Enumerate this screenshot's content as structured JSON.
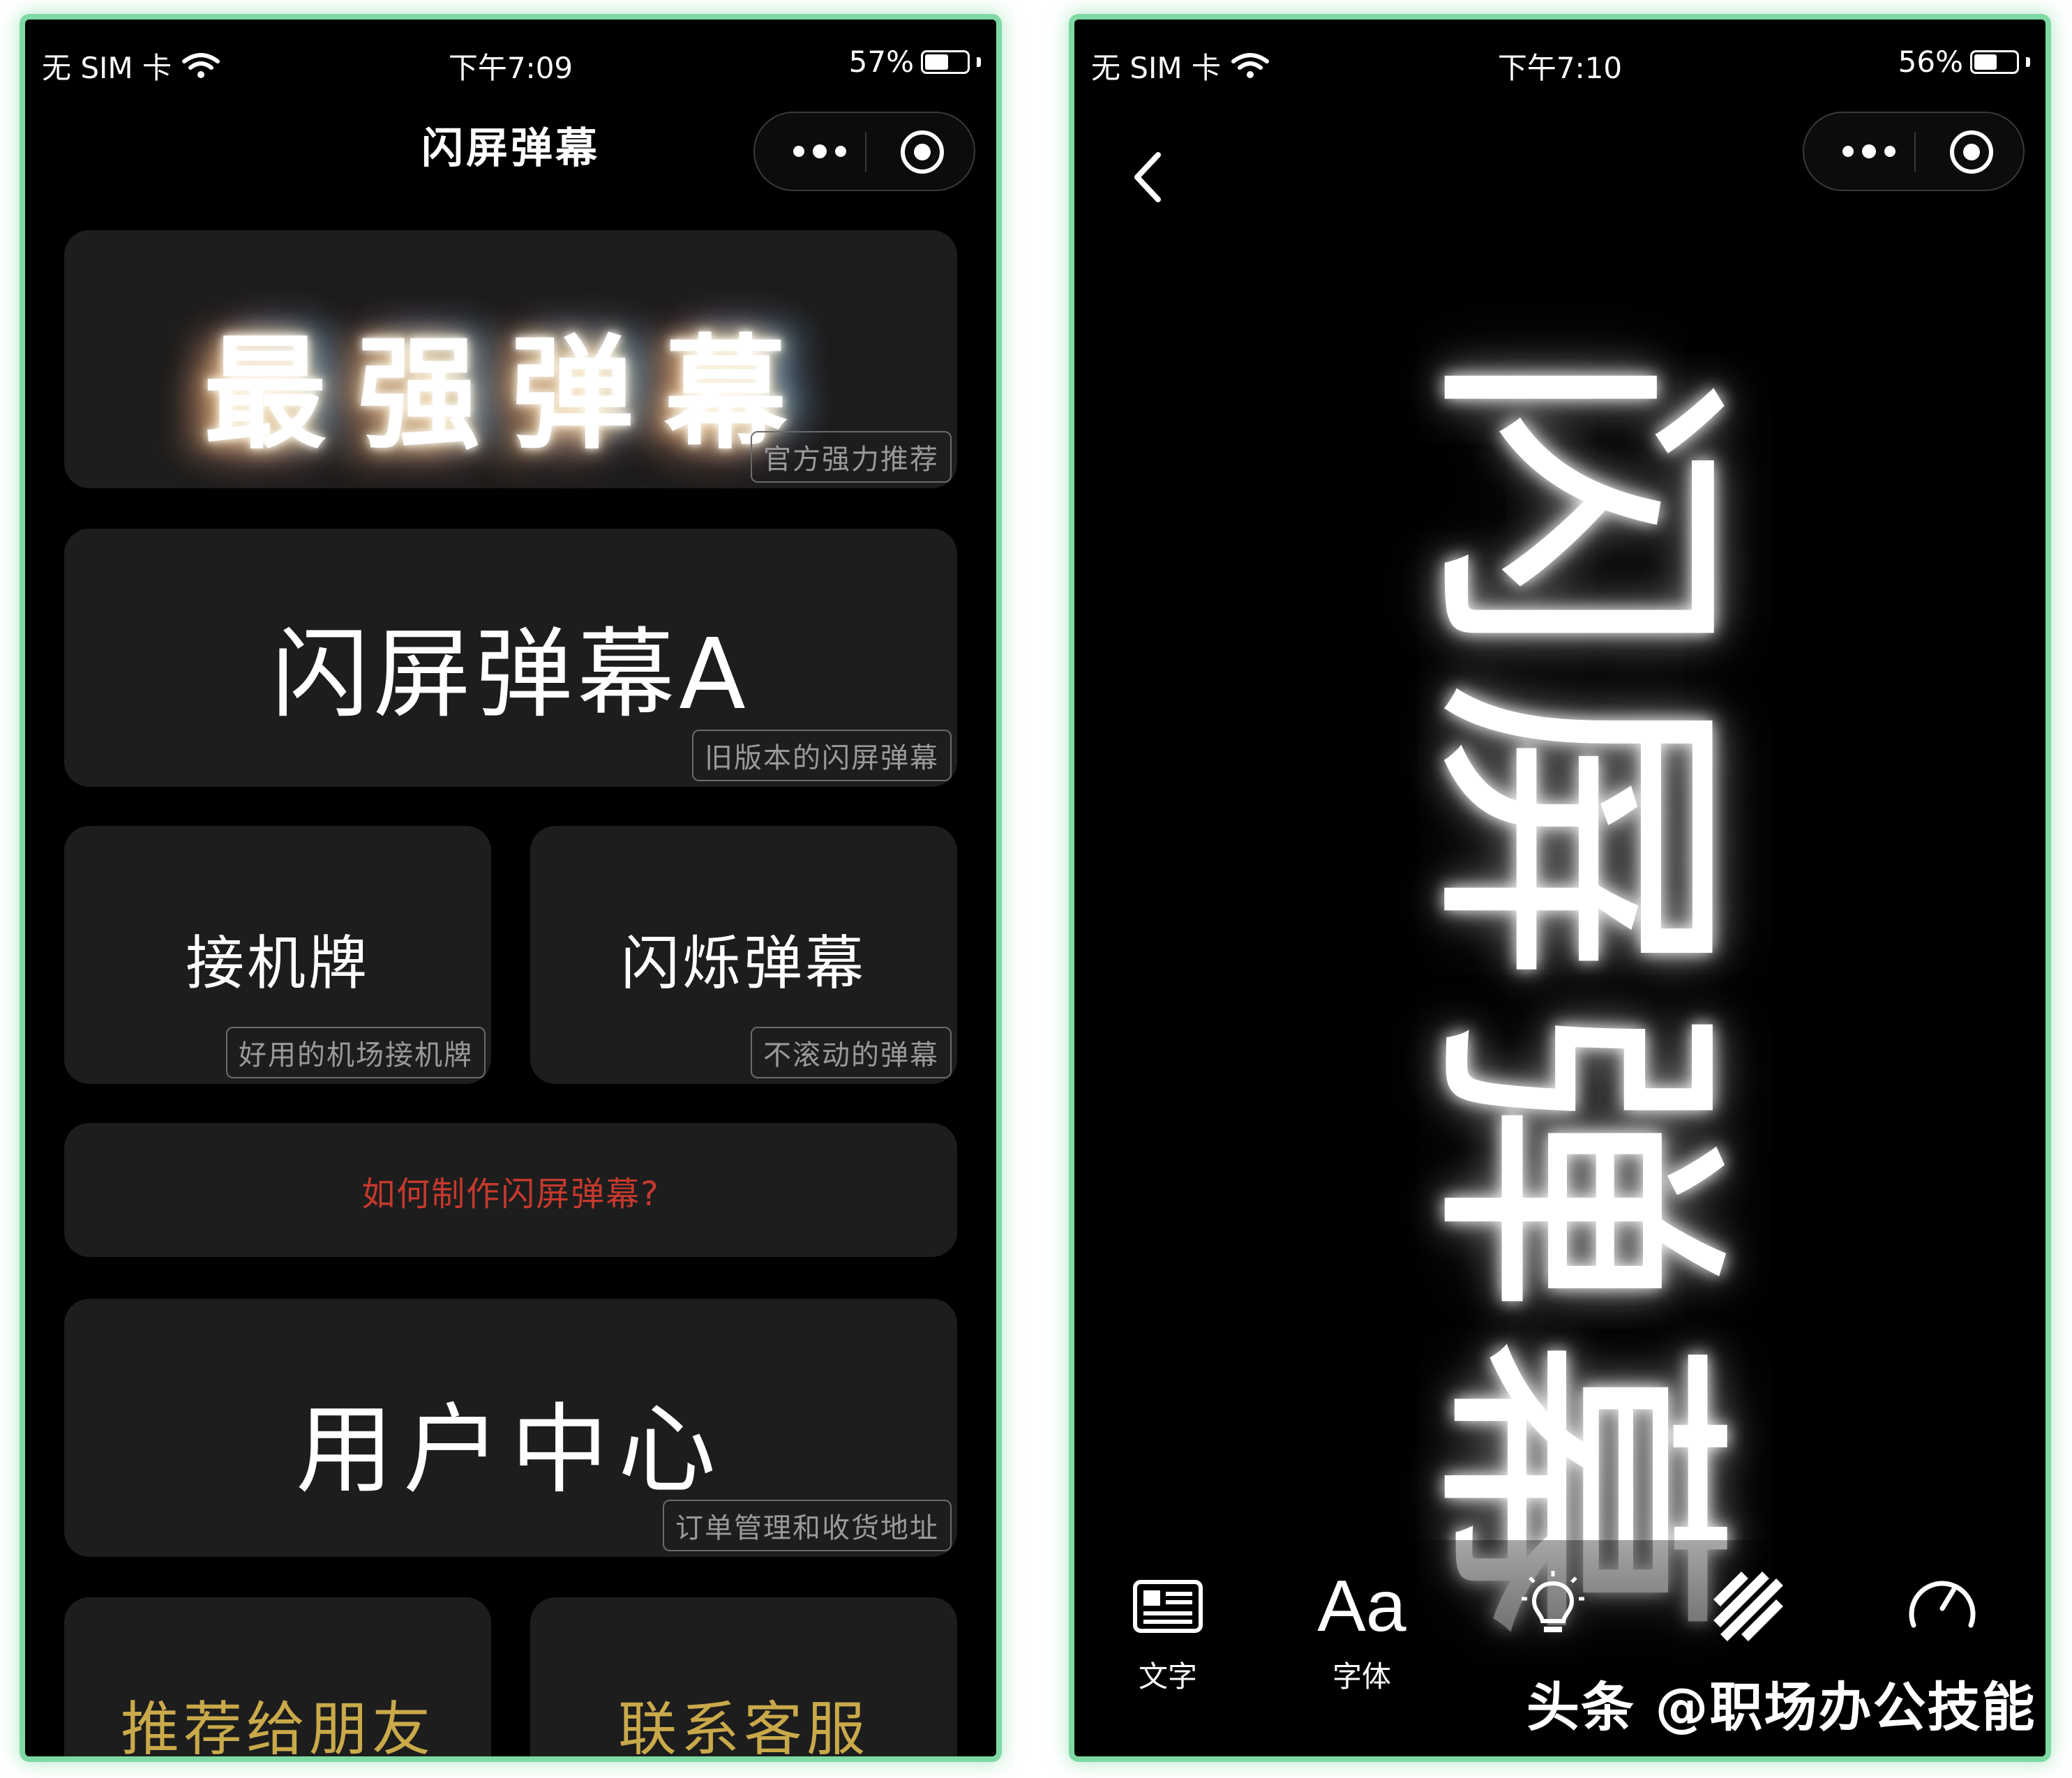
{
  "left": {
    "status": {
      "carrier": "无 SIM 卡",
      "time": "下午7:09",
      "battery": "57%",
      "battery_level": 0.57
    },
    "title": "闪屏弹幕",
    "cards": {
      "top": {
        "label": "最强弹幕",
        "tag": "官方强力推荐"
      },
      "a": {
        "label": "闪屏弹幕A",
        "tag": "旧版本的闪屏弹幕"
      },
      "pickup": {
        "label": "接机牌",
        "tag": "好用的机场接机牌"
      },
      "flash": {
        "label": "闪烁弹幕",
        "tag": "不滚动的弹幕"
      },
      "howto": {
        "label": "如何制作闪屏弹幕?"
      },
      "user": {
        "label": "用户中心",
        "tag": "订单管理和收货地址"
      },
      "share": {
        "label": "推荐给朋友"
      },
      "contact": {
        "label": "联系客服"
      }
    }
  },
  "right": {
    "status": {
      "carrier": "无 SIM 卡",
      "time": "下午7:10",
      "battery": "56%",
      "battery_level": 0.56
    },
    "display_chars": [
      "闪",
      "屏",
      "弹",
      "幕"
    ],
    "toolbar": [
      {
        "label": "文字",
        "icon": "text-icon"
      },
      {
        "label": "字体",
        "icon": "font-icon",
        "glyph": "Aa"
      },
      {
        "label": "",
        "icon": "lightbulb-icon"
      },
      {
        "label": "",
        "icon": "stripes-icon"
      },
      {
        "label": "",
        "icon": "speed-gauge-icon"
      }
    ],
    "watermark": "头条 @职场办公技能"
  },
  "colors": {
    "frame": "#7fd9a3",
    "card": "#1d1d1d",
    "howto": "#c5392d",
    "gold": "#c9a94a"
  }
}
